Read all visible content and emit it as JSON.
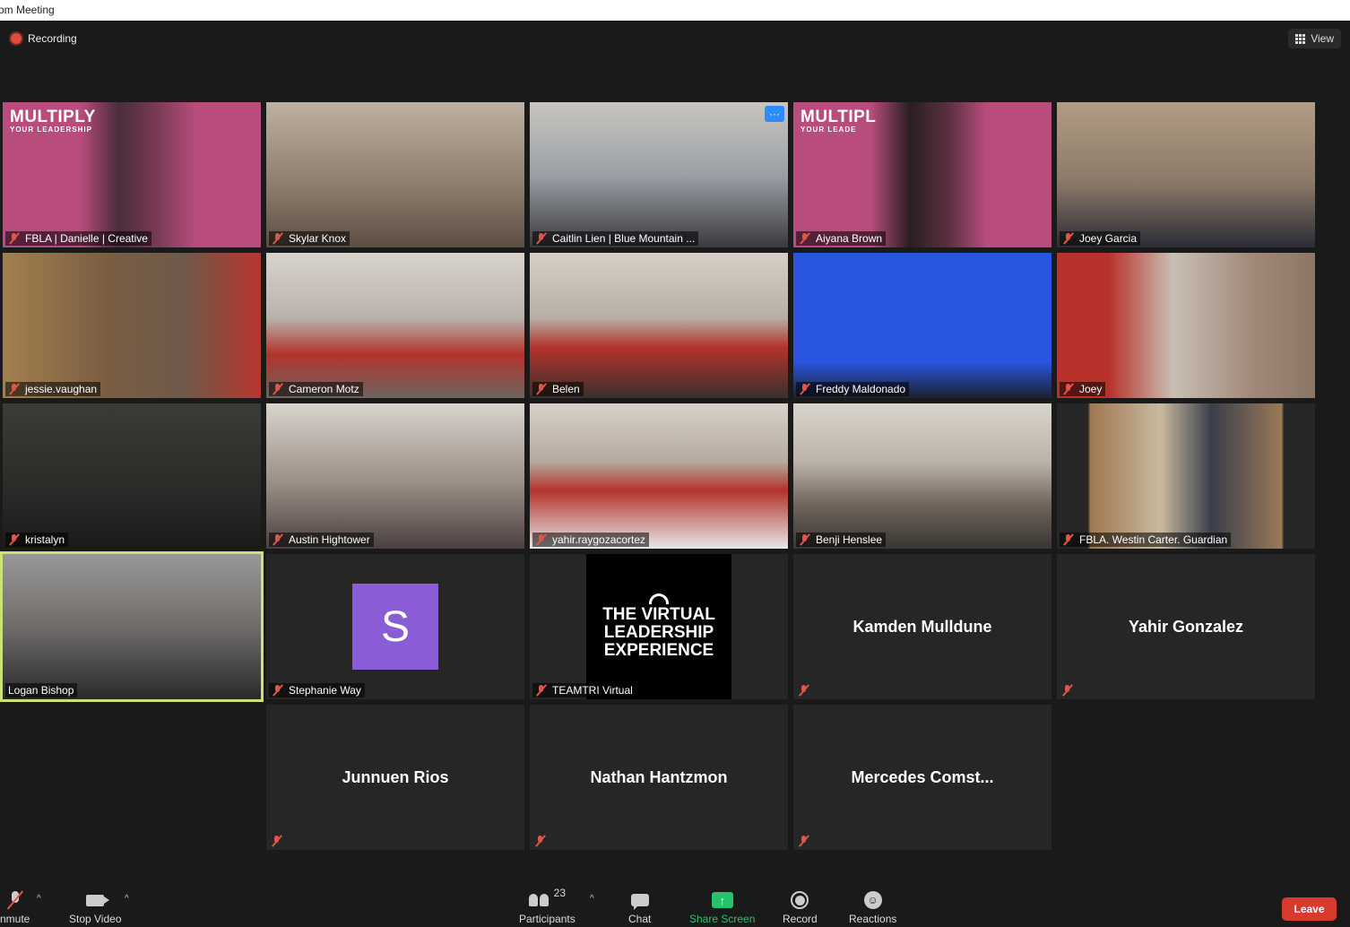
{
  "window": {
    "title": "om Meeting"
  },
  "topbar": {
    "recording_label": "Recording",
    "view_label": "View"
  },
  "tiles": [
    {
      "name": "FBLA | Danielle | Creative",
      "bg": "#b84d7d"
    },
    {
      "name": "Skylar Knox",
      "bg": "#8a7b6a"
    },
    {
      "name": "Caitlin Lien | Blue Mountain ...",
      "bg": "#9aa0a6"
    },
    {
      "name": "Aiyana Brown",
      "bg": "#b84d7d"
    },
    {
      "name": "Joey Garcia",
      "bg": "#8b7a68"
    },
    {
      "name": "jessie.vaughan",
      "bg": "#6e5a4a"
    },
    {
      "name": "Cameron Motz",
      "bg": "#8e8a86"
    },
    {
      "name": "Belen",
      "bg": "#8e8a86"
    },
    {
      "name": "Freddy Maldonado",
      "bg": "#2a55e0"
    },
    {
      "name": "Joey",
      "bg": "#a28a7a"
    },
    {
      "name": "kristalyn",
      "bg": "#2a2b28"
    },
    {
      "name": "Austin Hightower",
      "bg": "#9a8e86"
    },
    {
      "name": "yahir.raygozacortez",
      "bg": "#9a8a80"
    },
    {
      "name": "Benji Henslee",
      "bg": "#8d8278"
    },
    {
      "name": "FBLA.  Westin Carter. Guardian",
      "bg": "#7a7066"
    },
    {
      "name": "Logan Bishop",
      "bg": "#6f6c6a"
    },
    {
      "name": "Stephanie Way",
      "avatar_letter": "S"
    },
    {
      "name": "TEAMTRI Virtual",
      "logo": {
        "line1": "THE VIRTUAL",
        "line2": "LEADERSHIP",
        "line3": "EXPERIENCE"
      }
    },
    {
      "name": "Kamden Mulldune"
    },
    {
      "name": "Yahir Gonzalez"
    },
    {
      "name": "Junnuen Rios"
    },
    {
      "name": "Nathan Hantzmon"
    },
    {
      "name": "Mercedes  Comst..."
    }
  ],
  "branding": {
    "multiply": "MULTIPLY",
    "multiply_sub": "YOUR LEADERSHIP",
    "multiply_cut": "MULTIPL",
    "multiply_sub_cut": "YOUR LEADE"
  },
  "more_button": "···",
  "toolbar": {
    "unmute": "nmute",
    "stop_video": "Stop Video",
    "participants": "Participants",
    "participants_count": "23",
    "chat": "Chat",
    "share_screen": "Share Screen",
    "record": "Record",
    "reactions": "Reactions",
    "leave": "Leave"
  }
}
